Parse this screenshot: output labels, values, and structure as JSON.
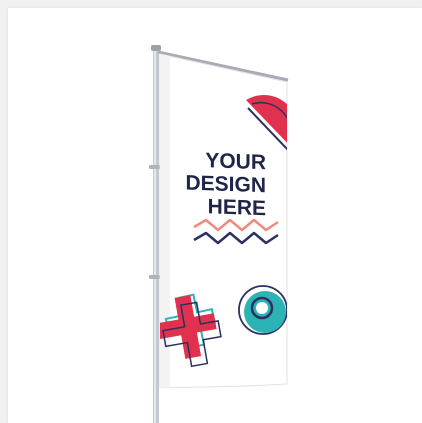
{
  "banner": {
    "line1": "YOUR",
    "line2": "DESIGN",
    "line3": "HERE"
  },
  "colors": {
    "background": "#f1f1f1",
    "card": "#ffffff",
    "text": "#1f2547",
    "accent_red": "#e0324f",
    "accent_teal": "#2bb3b5",
    "accent_salmon": "#f08a7a",
    "accent_navy": "#2a3160",
    "pole": "#b9bcc4"
  },
  "icons": [
    "half-circle-shape",
    "zigzag-lines-shape",
    "cross-shape",
    "target-circle-shape"
  ]
}
